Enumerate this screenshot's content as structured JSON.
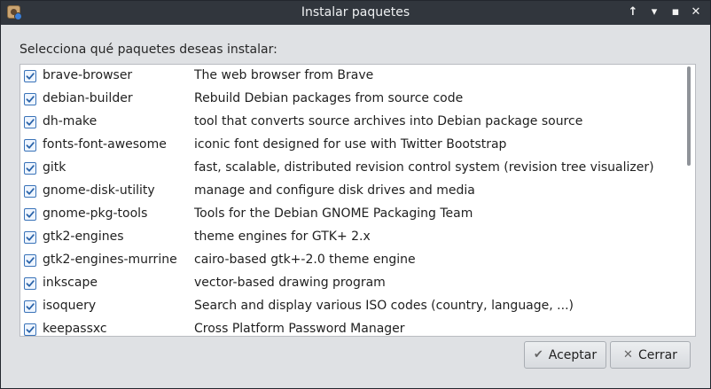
{
  "window": {
    "title": "Instalar paquetes",
    "controls": {
      "keep_above": "↑",
      "minimize": "▾",
      "maximize": "▪",
      "close": "✕"
    }
  },
  "prompt": "Selecciona qué paquetes deseas instalar:",
  "packages": [
    {
      "name": "brave-browser",
      "description": "The web browser from Brave",
      "checked": true
    },
    {
      "name": "debian-builder",
      "description": "Rebuild Debian packages from source code",
      "checked": true
    },
    {
      "name": "dh-make",
      "description": "tool that converts source archives into Debian package source",
      "checked": true
    },
    {
      "name": "fonts-font-awesome",
      "description": "iconic font designed for use with Twitter Bootstrap",
      "checked": true
    },
    {
      "name": "gitk",
      "description": "fast, scalable, distributed revision control system (revision tree visualizer)",
      "checked": true
    },
    {
      "name": "gnome-disk-utility",
      "description": "manage and configure disk drives and media",
      "checked": true
    },
    {
      "name": "gnome-pkg-tools",
      "description": "Tools for the Debian GNOME Packaging Team",
      "checked": true
    },
    {
      "name": "gtk2-engines",
      "description": "theme engines for GTK+ 2.x",
      "checked": true
    },
    {
      "name": "gtk2-engines-murrine",
      "description": "cairo-based gtk+-2.0 theme engine",
      "checked": true
    },
    {
      "name": "inkscape",
      "description": "vector-based drawing program",
      "checked": true
    },
    {
      "name": "isoquery",
      "description": "Search and display various ISO codes (country, language, ...)",
      "checked": true
    },
    {
      "name": "keepassxc",
      "description": "Cross Platform Password Manager",
      "checked": true
    }
  ],
  "buttons": {
    "accept": {
      "label": "Aceptar",
      "icon": "check-icon"
    },
    "cancel": {
      "label": "Cerrar",
      "icon": "close-icon"
    }
  },
  "colors": {
    "titlebar": "#31363d",
    "checkbox_accent": "#3a73b8",
    "dialog_bg": "#dfe1e4"
  }
}
